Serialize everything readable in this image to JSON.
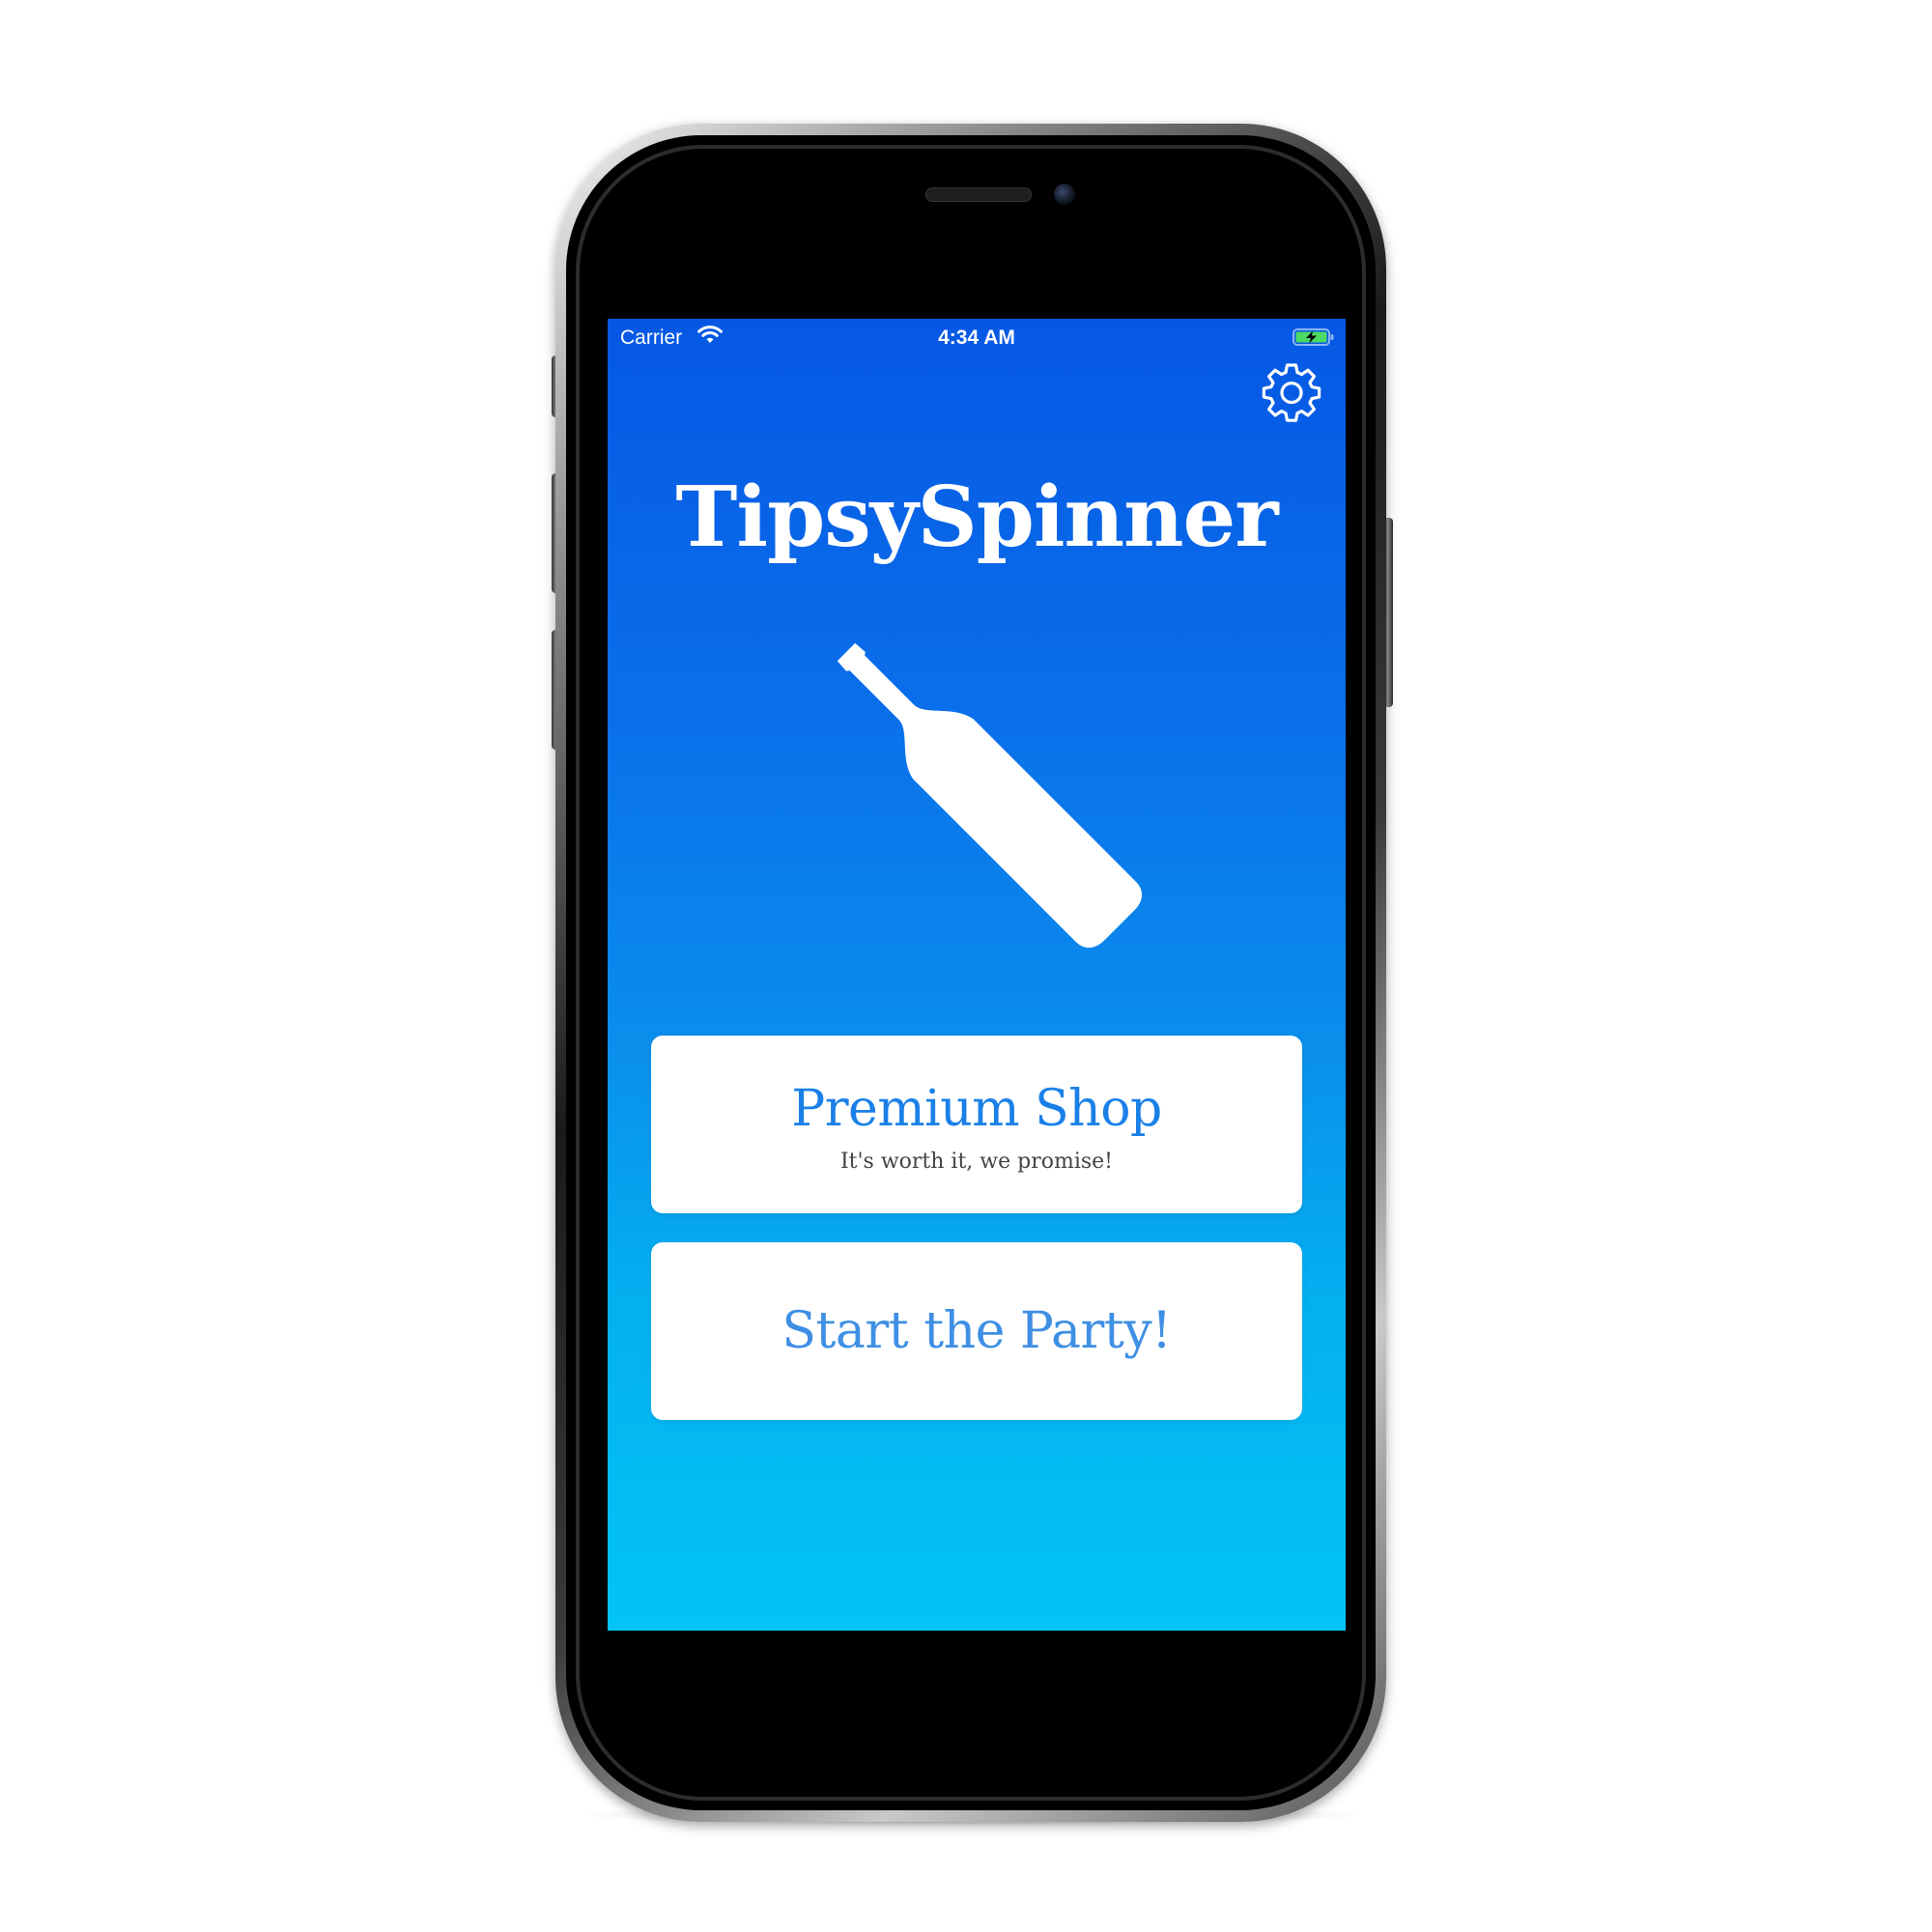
{
  "status_bar": {
    "carrier": "Carrier",
    "time": "4:34 AM",
    "wifi_icon": "wifi-icon",
    "battery_icon": "battery-charging-icon"
  },
  "header": {
    "settings_icon": "gear-icon"
  },
  "app": {
    "title": "TipsySpinner",
    "hero_icon": "bottle-icon"
  },
  "buttons": {
    "premium_shop": {
      "label": "Premium Shop",
      "subtitle": "It's worth it, we promise!"
    },
    "start_party": {
      "label": "Start the Party!"
    }
  },
  "colors": {
    "gradient_top": "#0658e4",
    "gradient_bottom": "#03c4f6",
    "button_text": "#1a80e8",
    "battery_charge": "#4cd964"
  }
}
